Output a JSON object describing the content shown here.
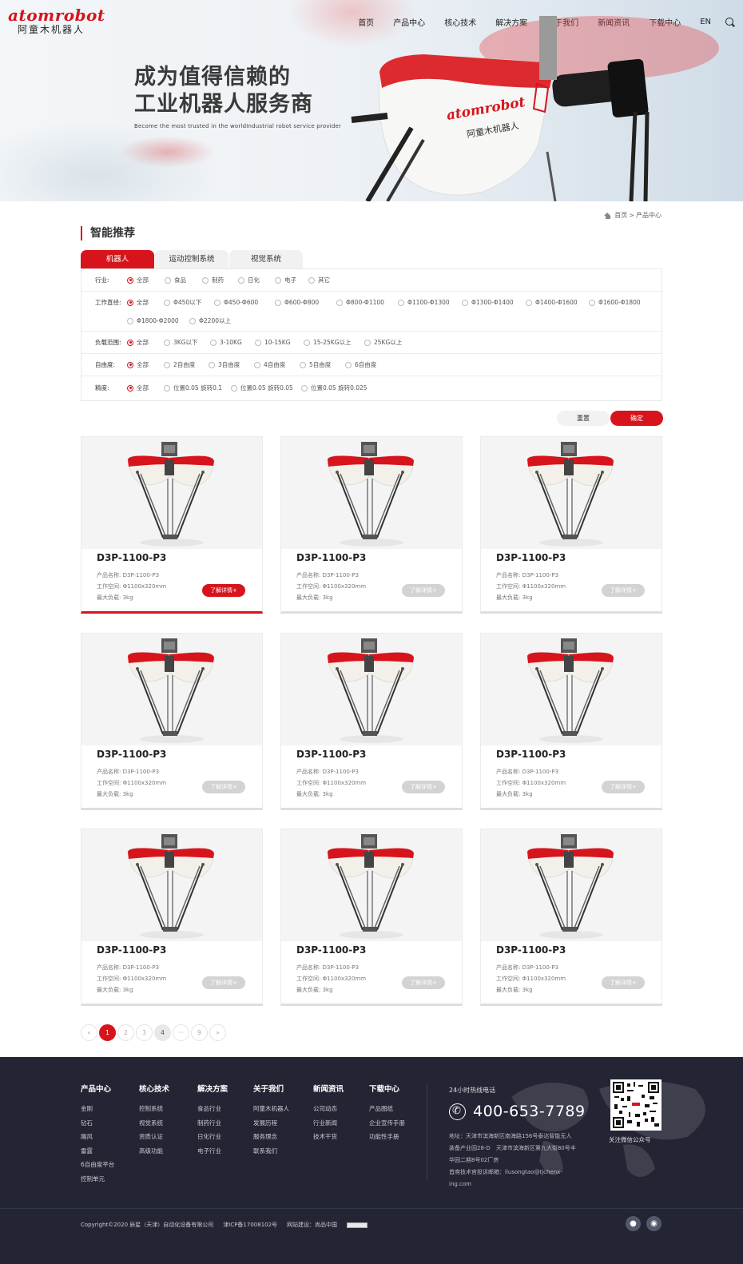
{
  "header": {
    "logo_en": "atomrobot",
    "logo_cn": "阿童木机器人",
    "nav": [
      "首页",
      "产品中心",
      "核心技术",
      "解决方案",
      "关于我们",
      "新闻资讯",
      "下载中心",
      "EN"
    ],
    "slogan_line1": "成为值得信赖的",
    "slogan_line2": "工业机器人服务商",
    "slogan_en": "Become the most trusted in the worldIndustrial robot service provider",
    "robot_logo": "atomrobot",
    "robot_cn": "阿童木机器人"
  },
  "breadcrumb": {
    "home": "首页",
    "sep": ">",
    "current": "产品中心"
  },
  "section_title": "智能推荐",
  "tabs": [
    "机器人",
    "运动控制系统",
    "视觉系统"
  ],
  "filters": [
    {
      "label": "行业:",
      "options": [
        "全部",
        "食品",
        "制药",
        "日化",
        "电子",
        "其它"
      ]
    },
    {
      "label": "工作直径:",
      "options": [
        "全部",
        "Φ450以下",
        "Φ450-Φ600",
        "Φ600-Φ800",
        "Φ800-Φ1100",
        "Φ1100-Φ1300",
        "Φ1300-Φ1400",
        "Φ1400-Φ1600",
        "Φ1600-Φ1800",
        "Φ1800-Φ2000",
        "Φ2200以上"
      ]
    },
    {
      "label": "负载范围:",
      "options": [
        "全部",
        "3KG以下",
        "3-10KG",
        "10-15KG",
        "15-25KG以上",
        "25KG以上"
      ]
    },
    {
      "label": "自由度:",
      "options": [
        "全部",
        "2自由度",
        "3自由度",
        "4自由度",
        "5自由度",
        "6自由度"
      ]
    },
    {
      "label": "精度:",
      "options": [
        "全部",
        "位置0.05 旋转0.1",
        "位置0.05 旋转0.05",
        "位置0.05 旋转0.025"
      ]
    }
  ],
  "buttons": {
    "reset": "重置",
    "confirm": "确定"
  },
  "products": [
    {
      "name": "D3P-1100-P3",
      "l1": "产品名称: D3P-1100-P3",
      "l2": "工作空间: Φ1100x320mm",
      "l3": "最大负载: 3kg",
      "btn": "了解详情+"
    },
    {
      "name": "D3P-1100-P3",
      "l1": "产品名称: D3P-1100-P3",
      "l2": "工作空间: Φ1100x320mm",
      "l3": "最大负载: 3kg",
      "btn": "了解详情+"
    },
    {
      "name": "D3P-1100-P3",
      "l1": "产品名称: D3P-1100-P3",
      "l2": "工作空间: Φ1100x320mm",
      "l3": "最大负载: 3kg",
      "btn": "了解详情+"
    },
    {
      "name": "D3P-1100-P3",
      "l1": "产品名称: D3P-1100-P3",
      "l2": "工作空间: Φ1100x320mm",
      "l3": "最大负载: 3kg",
      "btn": "了解详情+"
    },
    {
      "name": "D3P-1100-P3",
      "l1": "产品名称: D3P-1100-P3",
      "l2": "工作空间: Φ1100x320mm",
      "l3": "最大负载: 3kg",
      "btn": "了解详情+"
    },
    {
      "name": "D3P-1100-P3",
      "l1": "产品名称: D3P-1100-P3",
      "l2": "工作空间: Φ1100x320mm",
      "l3": "最大负载: 3kg",
      "btn": "了解详情+"
    },
    {
      "name": "D3P-1100-P3",
      "l1": "产品名称: D3P-1100-P3",
      "l2": "工作空间: Φ1100x320mm",
      "l3": "最大负载: 3kg",
      "btn": "了解详情+"
    },
    {
      "name": "D3P-1100-P3",
      "l1": "产品名称: D3P-1100-P3",
      "l2": "工作空间: Φ1100x320mm",
      "l3": "最大负载: 3kg",
      "btn": "了解详情+"
    },
    {
      "name": "D3P-1100-P3",
      "l1": "产品名称: D3P-1100-P3",
      "l2": "工作空间: Φ1100x320mm",
      "l3": "最大负载: 3kg",
      "btn": "了解详情+"
    }
  ],
  "pagination": [
    "«",
    "1",
    "2",
    "3",
    "4",
    "···",
    "9",
    "»"
  ],
  "footer": {
    "columns": [
      {
        "title": "产品中心",
        "items": [
          "金刚",
          "钻石",
          "飓风",
          "雷霆",
          "6自由度平台",
          "控制单元"
        ]
      },
      {
        "title": "核心技术",
        "items": [
          "控制系统",
          "视觉系统",
          "资质认证",
          "高级功能"
        ]
      },
      {
        "title": "解决方案",
        "items": [
          "食品行业",
          "制药行业",
          "日化行业",
          "电子行业"
        ]
      },
      {
        "title": "关于我们",
        "items": [
          "阿童木机器人",
          "发展历程",
          "服务理念",
          "联系我们"
        ]
      },
      {
        "title": "新闻资讯",
        "items": [
          "公司动态",
          "行业新闻",
          "技术干货"
        ]
      },
      {
        "title": "下载中心",
        "items": [
          "产品图纸",
          "企业宣传手册",
          "功能性手册"
        ]
      }
    ],
    "hotline_label": "24小时热线电话",
    "phone": "400-653-7789",
    "address": "地址：天津市滨海新区南海路156号泰达智能无人装备产业园28-D　天津市滨海新区第九大街80号丰华园二期8号02厂房",
    "email": "首席技术官投诉邮箱：liusongtao@tjchenx-ing.com",
    "qr_label": "关注微信公众号",
    "copyright": "Copyright©2020 辰星（天津）自动化设备有限公司",
    "icp": "津ICP备17008102号",
    "built_by": "网站建设：尚品中国"
  }
}
